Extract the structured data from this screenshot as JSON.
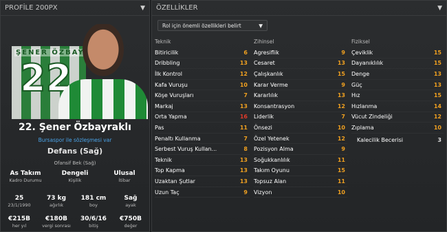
{
  "left_panel": {
    "header": "PROFİLE 200PX",
    "shirt_name": "ŞENER ÖZBAYR",
    "shirt_number": "22",
    "player_name": "22. Şener Özbayraklı",
    "contract": "Bursaspor ile sözleşmesi var",
    "position": "Defans (Sağ)",
    "role": "Ofansif Bek (Sağ)",
    "row1": [
      {
        "value": "As Takım",
        "label": "Kadro Durumu"
      },
      {
        "value": "Dengeli",
        "label": "Kişilik"
      },
      {
        "value": "Ulusal",
        "label": "İtibar"
      }
    ],
    "row2": [
      {
        "value": "25",
        "label": "23/1/1990"
      },
      {
        "value": "73 kg",
        "label": "ağırlık"
      },
      {
        "value": "181 cm",
        "label": "boy"
      },
      {
        "value": "Sağ",
        "label": "ayak"
      }
    ],
    "row3": [
      {
        "value": "€215B",
        "label": "her yıl"
      },
      {
        "value": "€180B",
        "label": "vergi sonrası"
      },
      {
        "value": "30/6/16",
        "label": "bitiş"
      },
      {
        "value": "€750B",
        "label": "değer"
      }
    ]
  },
  "right_panel": {
    "header": "ÖZELLİKLER",
    "role_select": "Rol için önemli özellikleri belirt",
    "teknik": {
      "title": "Teknik",
      "items": [
        {
          "name": "Bitiricilik",
          "value": "6",
          "color": "#f0a020"
        },
        {
          "name": "Dribbling",
          "value": "13",
          "color": "#f0a020"
        },
        {
          "name": "İlk Kontrol",
          "value": "12",
          "color": "#f0a020"
        },
        {
          "name": "Kafa Vuruşu",
          "value": "10",
          "color": "#f0a020"
        },
        {
          "name": "Köşe Vuruşları",
          "value": "7",
          "color": "#f0a020"
        },
        {
          "name": "Markaj",
          "value": "13",
          "color": "#f0a020"
        },
        {
          "name": "Orta Yapma",
          "value": "16",
          "color": "#e03a2a"
        },
        {
          "name": "Pas",
          "value": "11",
          "color": "#f0a020"
        },
        {
          "name": "Penaltı Kullanma",
          "value": "7",
          "color": "#f0a020"
        },
        {
          "name": "Serbest Vuruş Kullan...",
          "value": "8",
          "color": "#f0a020"
        },
        {
          "name": "Teknik",
          "value": "13",
          "color": "#f0a020"
        },
        {
          "name": "Top Kapma",
          "value": "13",
          "color": "#f0a020"
        },
        {
          "name": "Uzaktan Şutlar",
          "value": "13",
          "color": "#f0a020"
        },
        {
          "name": "Uzun Taç",
          "value": "9",
          "color": "#f0a020"
        }
      ]
    },
    "zihinsel": {
      "title": "Zihinsel",
      "items": [
        {
          "name": "Agresiflik",
          "value": "9",
          "color": "#f0a020"
        },
        {
          "name": "Cesaret",
          "value": "13",
          "color": "#f0a020"
        },
        {
          "name": "Çalışkanlık",
          "value": "15",
          "color": "#f0a020"
        },
        {
          "name": "Karar Verme",
          "value": "9",
          "color": "#f0a020"
        },
        {
          "name": "Kararlılık",
          "value": "13",
          "color": "#f0a020"
        },
        {
          "name": "Konsantrasyon",
          "value": "12",
          "color": "#f0a020"
        },
        {
          "name": "Liderlik",
          "value": "7",
          "color": "#f0a020"
        },
        {
          "name": "Önsezi",
          "value": "10",
          "color": "#f0a020"
        },
        {
          "name": "Özel Yetenek",
          "value": "12",
          "color": "#f0a020"
        },
        {
          "name": "Pozisyon Alma",
          "value": "9",
          "color": "#f0a020"
        },
        {
          "name": "Soğukkanlılık",
          "value": "11",
          "color": "#f0a020"
        },
        {
          "name": "Takım Oyunu",
          "value": "15",
          "color": "#f0a020"
        },
        {
          "name": "Topsuz Alan",
          "value": "11",
          "color": "#f0a020"
        },
        {
          "name": "Vizyon",
          "value": "10",
          "color": "#f0a020"
        }
      ]
    },
    "fiziksel": {
      "title": "Fiziksel",
      "items": [
        {
          "name": "Çeviklik",
          "value": "15",
          "color": "#f0a020"
        },
        {
          "name": "Dayanıklılık",
          "value": "15",
          "color": "#f0a020"
        },
        {
          "name": "Denge",
          "value": "13",
          "color": "#f0a020"
        },
        {
          "name": "Güç",
          "value": "13",
          "color": "#f0a020"
        },
        {
          "name": "Hız",
          "value": "15",
          "color": "#f0a020"
        },
        {
          "name": "Hızlanma",
          "value": "14",
          "color": "#f0a020"
        },
        {
          "name": "Vücut Zindeliği",
          "value": "12",
          "color": "#f0a020"
        },
        {
          "name": "Zıplama",
          "value": "10",
          "color": "#f0a020"
        }
      ],
      "extra": {
        "name": "Kalecilik Becerisi",
        "value": "3",
        "color": "#e0e0e0"
      }
    }
  }
}
